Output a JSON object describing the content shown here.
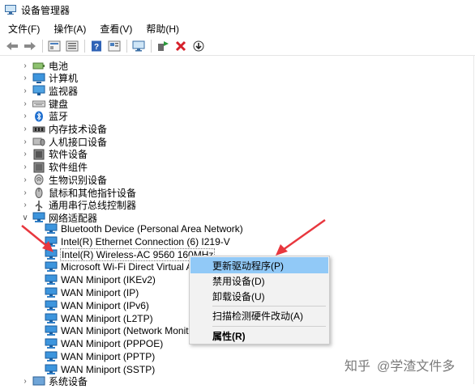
{
  "window": {
    "title": "设备管理器"
  },
  "menu": [
    "文件(F)",
    "操作(A)",
    "查看(V)",
    "帮助(H)"
  ],
  "toolbar": [
    "back-arrow-icon",
    "forward-arrow-icon",
    "properties-view-icon",
    "list-view-icon",
    "help-icon",
    "properties-icon",
    "monitor-scan-icon",
    "enable-driver-icon",
    "remove-device-icon",
    "download-driver-icon"
  ],
  "tree": {
    "categories_top": [
      {
        "label": "电池",
        "icon": "battery-icon"
      },
      {
        "label": "计算机",
        "icon": "computer-icon"
      },
      {
        "label": "监视器",
        "icon": "monitor-icon"
      },
      {
        "label": "键盘",
        "icon": "keyboard-icon"
      },
      {
        "label": "蓝牙",
        "icon": "bluetooth-icon"
      },
      {
        "label": "内存技术设备",
        "icon": "memory-icon"
      },
      {
        "label": "人机接口设备",
        "icon": "hid-icon"
      },
      {
        "label": "软件设备",
        "icon": "software-device-icon"
      },
      {
        "label": "软件组件",
        "icon": "software-component-icon"
      },
      {
        "label": "生物识别设备",
        "icon": "biometric-icon"
      },
      {
        "label": "鼠标和其他指针设备",
        "icon": "mouse-icon"
      },
      {
        "label": "通用串行总线控制器",
        "icon": "usb-icon"
      }
    ],
    "network_category": "网络适配器",
    "network_adapters": [
      "Bluetooth Device (Personal Area Network)",
      "Intel(R) Ethernet Connection (6) I219-V",
      "Intel(R) Wireless-AC 9560 160MHz",
      "Microsoft Wi-Fi Direct Virtual Ada",
      "WAN Miniport (IKEv2)",
      "WAN Miniport (IP)",
      "WAN Miniport (IPv6)",
      "WAN Miniport (L2TP)",
      "WAN Miniport (Network Monitor)",
      "WAN Miniport (PPPOE)",
      "WAN Miniport (PPTP)",
      "WAN Miniport (SSTP)"
    ],
    "bottom_category": "系统设备"
  },
  "context_menu": {
    "items": [
      "更新驱动程序(P)",
      "禁用设备(D)",
      "卸载设备(U)",
      "扫描检测硬件改动(A)",
      "属性(R)"
    ],
    "highlighted": 0
  },
  "watermark": {
    "platform": "知乎",
    "author": "@学渣文件多"
  },
  "colors": {
    "selection": "#91c9f7",
    "arrow": "#e8373e",
    "adapter_icon": "#2f8fd6"
  }
}
